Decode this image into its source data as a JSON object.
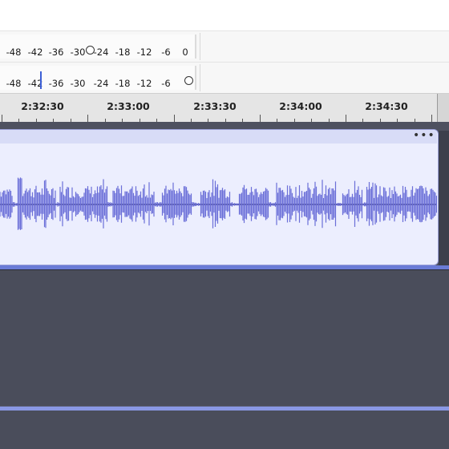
{
  "meters": {
    "record": {
      "labels": [
        "-48",
        "-42",
        "-36",
        "-30",
        "-24",
        "-18",
        "-12",
        "-6",
        "0"
      ],
      "knob_icon": "slider-knob-icon"
    },
    "playback": {
      "labels": [
        "-48",
        "-42",
        "-36",
        "-30",
        "-24",
        "-18",
        "-12",
        "-6"
      ],
      "knob_icon": "slider-knob-icon"
    }
  },
  "timeline": {
    "labels": [
      "2:32:30",
      "2:33:00",
      "2:33:30",
      "2:34:00",
      "2:34:30"
    ]
  },
  "clip": {
    "menu_label": "•••"
  },
  "colors": {
    "waveform": "#6b6fd8",
    "clip_background": "#eceefe",
    "track_background": "#4e5160",
    "cursor": "#3c5fd6"
  }
}
